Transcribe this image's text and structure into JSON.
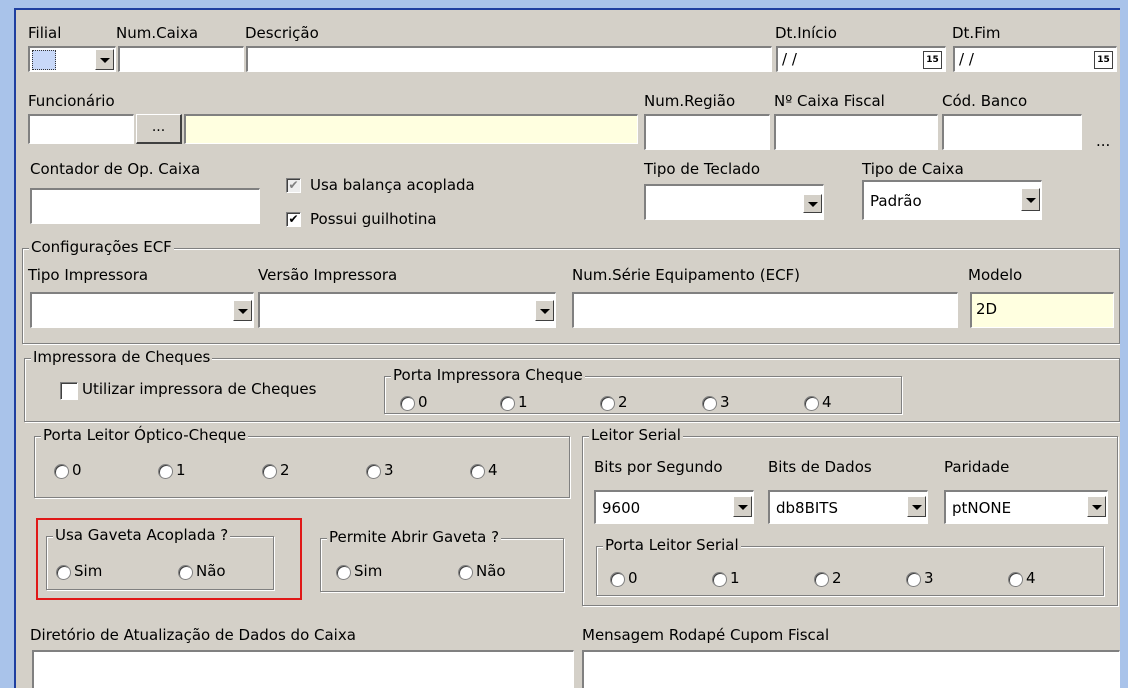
{
  "header": {
    "filial_label": "Filial",
    "num_caixa_label": "Num.Caixa",
    "descricao_label": "Descrição",
    "dt_inicio_label": "Dt.Início",
    "dt_inicio_value": "/ /",
    "dt_fim_label": "Dt.Fim",
    "dt_fim_value": "/ /",
    "calendar_glyph": "15"
  },
  "funcionario": {
    "label": "Funcionário",
    "ellipsis": "...",
    "num_regiao_label": "Num.Região",
    "caixa_fiscal_label": "Nº Caixa Fiscal",
    "cod_banco_label": "Cód. Banco",
    "cod_banco_ellipsis": "..."
  },
  "contador": {
    "label": "Contador de Op. Caixa",
    "balanca_label": "Usa balança acoplada",
    "balanca_checked": "✔",
    "guilhotina_label": "Possui guilhotina",
    "guilhotina_checked": "✔",
    "tipo_teclado_label": "Tipo de Teclado",
    "tipo_caixa_label": "Tipo de Caixa",
    "tipo_caixa_value": "Padrão"
  },
  "ecf": {
    "group_title": "Configurações ECF",
    "tipo_impressora_label": "Tipo Impressora",
    "versao_impressora_label": "Versão Impressora",
    "num_serie_label": "Num.Série Equipamento (ECF)",
    "modelo_label": "Modelo",
    "modelo_value": "2D"
  },
  "cheques": {
    "group_title": "Impressora de Cheques",
    "utilizar_label": "Utilizar impressora de Cheques",
    "porta_title": "Porta Impressora Cheque",
    "ports": [
      "0",
      "1",
      "2",
      "3",
      "4"
    ]
  },
  "leitor_optico": {
    "group_title": "Porta Leitor Óptico-Cheque",
    "ports": [
      "0",
      "1",
      "2",
      "3",
      "4"
    ]
  },
  "gaveta": {
    "usa_title": "Usa Gaveta Acoplada ?",
    "permite_title": "Permite Abrir Gaveta ?",
    "sim": "Sim",
    "nao": "Não"
  },
  "leitor_serial": {
    "group_title": "Leitor Serial",
    "bits_segundo_label": "Bits por Segundo",
    "bits_segundo_value": "9600",
    "bits_dados_label": "Bits de Dados",
    "bits_dados_value": "db8BITS",
    "paridade_label": "Paridade",
    "paridade_value": "ptNONE",
    "porta_title": "Porta Leitor Serial",
    "ports": [
      "0",
      "1",
      "2",
      "3",
      "4"
    ]
  },
  "footer": {
    "diretorio_label": "Diretório de Atualização de Dados do Caixa",
    "mensagem_label": "Mensagem Rodapé Cupom Fiscal"
  },
  "colors": {
    "window_bg": "#d4d0c8",
    "outer_bg": "#a9c3ea",
    "highlight_red": "#e01818",
    "readonly_yellow": "#ffffe0"
  }
}
